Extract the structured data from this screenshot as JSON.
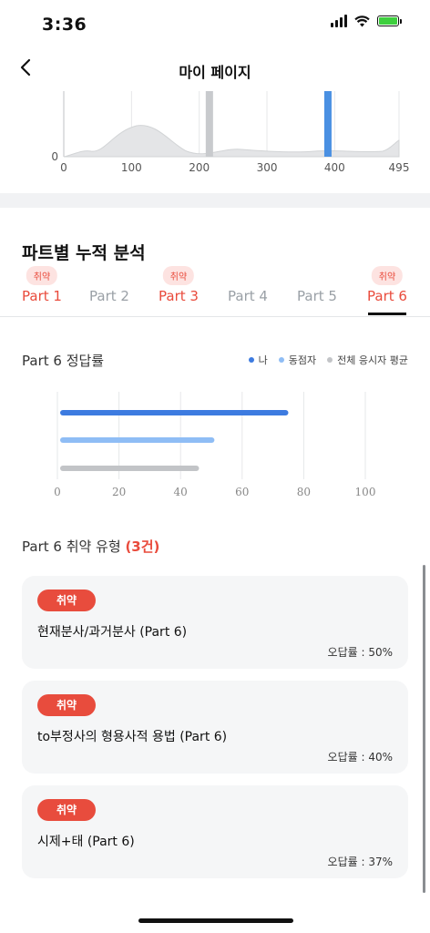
{
  "status": {
    "time": "3:36"
  },
  "header": {
    "title": "마이 페이지"
  },
  "distribution": {
    "x_ticks": [
      "0",
      "100",
      "200",
      "300",
      "400",
      "495"
    ],
    "y_tick": "0",
    "x_range": [
      0,
      495
    ],
    "markers": [
      {
        "value": 215,
        "color": "#c8cacd"
      },
      {
        "value": 390,
        "color": "#4a90e2"
      }
    ]
  },
  "section": {
    "title": "파트별 누적 분석"
  },
  "tabs": [
    {
      "label": "Part 1",
      "weak": true,
      "badge": "취약"
    },
    {
      "label": "Part 2",
      "weak": false,
      "badge": ""
    },
    {
      "label": "Part 3",
      "weak": true,
      "badge": "취약"
    },
    {
      "label": "Part 4",
      "weak": false,
      "badge": ""
    },
    {
      "label": "Part 5",
      "weak": false,
      "badge": ""
    },
    {
      "label": "Part 6",
      "weak": true,
      "badge": "취약",
      "selected": true
    }
  ],
  "accuracy": {
    "title": "Part 6 정답률",
    "legend": [
      {
        "label": "나",
        "color": "#3d7be0"
      },
      {
        "label": "동점자",
        "color": "#8fbdf5"
      },
      {
        "label": "전체 응시자 평균",
        "color": "#c2c4c7"
      }
    ]
  },
  "chart_data": {
    "type": "bar",
    "orientation": "horizontal",
    "series": [
      {
        "name": "나",
        "values": [
          75
        ],
        "color": "#3d7be0"
      },
      {
        "name": "동점자",
        "values": [
          51
        ],
        "color": "#8fbdf5"
      },
      {
        "name": "전체 응시자 평균",
        "values": [
          46
        ],
        "color": "#c2c4c7"
      }
    ],
    "x_ticks": [
      0,
      20,
      40,
      60,
      80,
      100
    ],
    "xlim": [
      0,
      100
    ],
    "grid": true,
    "legend_placement": "top-right"
  },
  "weak_types": {
    "title_prefix": "Part 6 취약 유형 ",
    "count": "(3건)",
    "items": [
      {
        "chip": "취약",
        "title": "현재분사/과거분사 (Part 6)",
        "rate": "오답률 : 50%"
      },
      {
        "chip": "취약",
        "title": "to부정사의 형용사적 용법 (Part 6)",
        "rate": "오답률 : 40%"
      },
      {
        "chip": "취약",
        "title": "시제+태 (Part 6)",
        "rate": "오답률 : 37%"
      }
    ]
  }
}
